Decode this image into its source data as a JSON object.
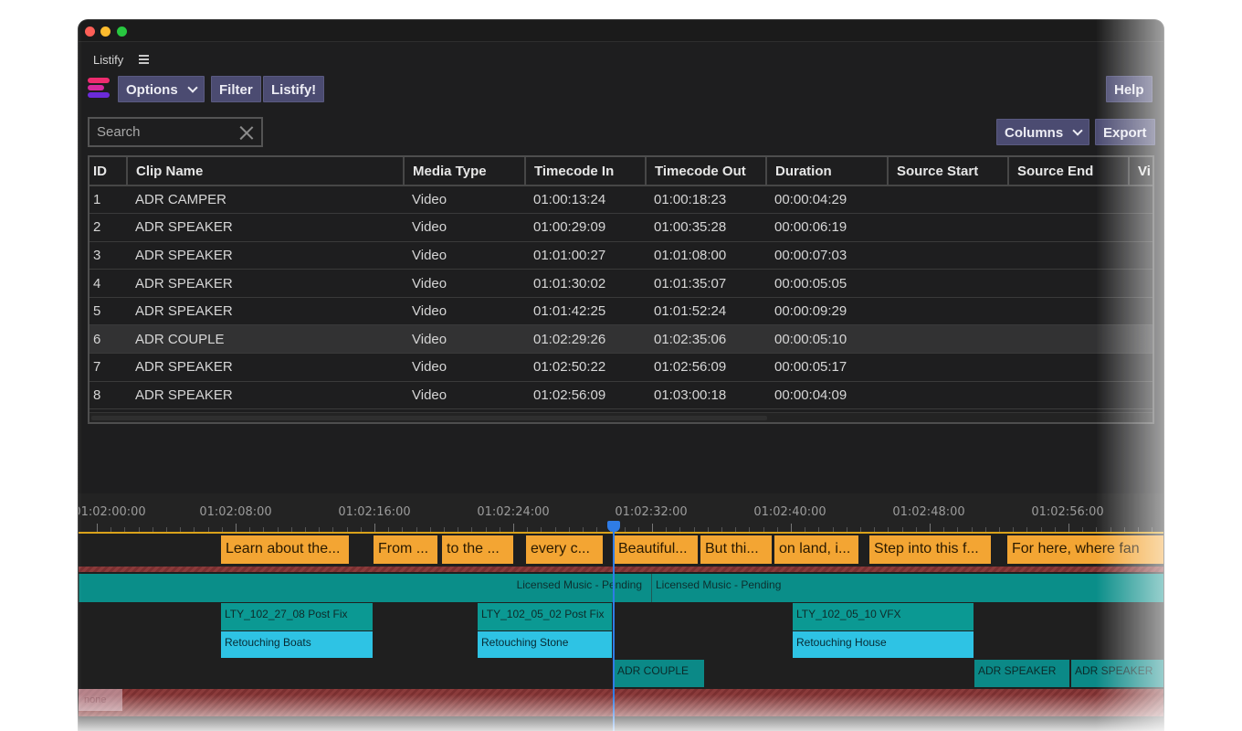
{
  "app": {
    "panel_title": "Listify"
  },
  "toolbar": {
    "options_label": "Options",
    "filter_label": "Filter",
    "listify_label": "Listify!",
    "help_label": "Help",
    "columns_label": "Columns",
    "export_label": "Export"
  },
  "search": {
    "placeholder": "Search"
  },
  "table": {
    "columns": [
      "ID",
      "Clip Name",
      "Media Type",
      "Timecode In",
      "Timecode Out",
      "Duration",
      "Source Start",
      "Source End",
      "Vi"
    ],
    "rows": [
      [
        "1",
        "ADR CAMPER",
        "Video",
        "01:00:13:24",
        "01:00:18:23",
        "00:00:04:29",
        "",
        "",
        ""
      ],
      [
        "2",
        "ADR SPEAKER",
        "Video",
        "01:00:29:09",
        "01:00:35:28",
        "00:00:06:19",
        "",
        "",
        ""
      ],
      [
        "3",
        "ADR SPEAKER",
        "Video",
        "01:01:00:27",
        "01:01:08:00",
        "00:00:07:03",
        "",
        "",
        ""
      ],
      [
        "4",
        "ADR SPEAKER",
        "Video",
        "01:01:30:02",
        "01:01:35:07",
        "00:00:05:05",
        "",
        "",
        ""
      ],
      [
        "5",
        "ADR SPEAKER",
        "Video",
        "01:01:42:25",
        "01:01:52:24",
        "00:00:09:29",
        "",
        "",
        ""
      ],
      [
        "6",
        "ADR COUPLE",
        "Video",
        "01:02:29:26",
        "01:02:35:06",
        "00:00:05:10",
        "",
        "",
        ""
      ],
      [
        "7",
        "ADR SPEAKER",
        "Video",
        "01:02:50:22",
        "01:02:56:09",
        "00:00:05:17",
        "",
        "",
        ""
      ],
      [
        "8",
        "ADR SPEAKER",
        "Video",
        "01:02:56:09",
        "01:03:00:18",
        "00:00:04:09",
        "",
        "",
        ""
      ]
    ],
    "selected_row": 6
  },
  "timeline": {
    "ruler_labels": [
      "01:02:00:00",
      "01:02:08:00",
      "01:02:16:00",
      "01:02:24:00",
      "01:02:32:00",
      "01:02:40:00",
      "01:02:48:00",
      "01:02:56:00"
    ],
    "pink_stub_label": "none",
    "captions": [
      "Learn about the...",
      "From ...",
      "to the ...",
      "every c...",
      "Beautiful...",
      "But thi...",
      "on land, i...",
      "Step into this f...",
      "For here, where fan"
    ],
    "music": [
      "Licensed Music - Pending",
      "Licensed Music - Pending"
    ],
    "vfx": [
      "LTY_102_27_08 Post Fix",
      "LTY_102_05_02 Post Fix",
      "LTY_102_05_10 VFX"
    ],
    "retouch": [
      "Retouching Boats",
      "Retouching Stone",
      "Retouching House"
    ],
    "adr": [
      "ADR COUPLE",
      "ADR SPEAKER",
      "ADR SPEAKER"
    ]
  },
  "colors": {
    "button_bg": "#4b4b71",
    "caption": "#f3a533",
    "music": "#0a8e89",
    "retouch": "#2ec3e4",
    "playhead": "#2f7ce6"
  }
}
